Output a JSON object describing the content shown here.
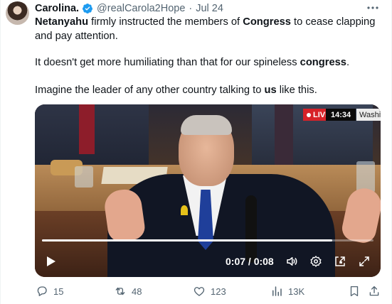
{
  "author": {
    "name": "Carolina.",
    "handle": "@realCarola2Hope",
    "separator": "·",
    "date": "Jul 24",
    "verified": true
  },
  "text": {
    "p1a": "Netanyahu",
    "p1b": " firmly instructed the members of ",
    "p1c": "Congress",
    "p1d": " to cease clapping and pay attention.",
    "p2a": "It doesn't get more humiliating than that for our spineless ",
    "p2b": "congress",
    "p2c": ".",
    "p3a": "Imagine the leader of any other country talking to ",
    "p3b": "us",
    "p3c": " like this."
  },
  "video": {
    "live_label": "LIVE",
    "clock": "14:34",
    "station": "Washi",
    "time": "0:07 / 0:08",
    "progress": 0.875
  },
  "actions": {
    "replies": "15",
    "reposts": "48",
    "likes": "123",
    "views": "13K"
  },
  "colors": {
    "accent": "#1d9bf0",
    "muted": "#536471",
    "live": "#d72228"
  },
  "icons": [
    "verified-badge-icon",
    "more-icon",
    "play-icon",
    "volume-icon",
    "settings-icon",
    "pip-icon",
    "fullscreen-icon",
    "reply-icon",
    "repost-icon",
    "like-icon",
    "views-icon",
    "bookmark-icon",
    "share-icon"
  ]
}
